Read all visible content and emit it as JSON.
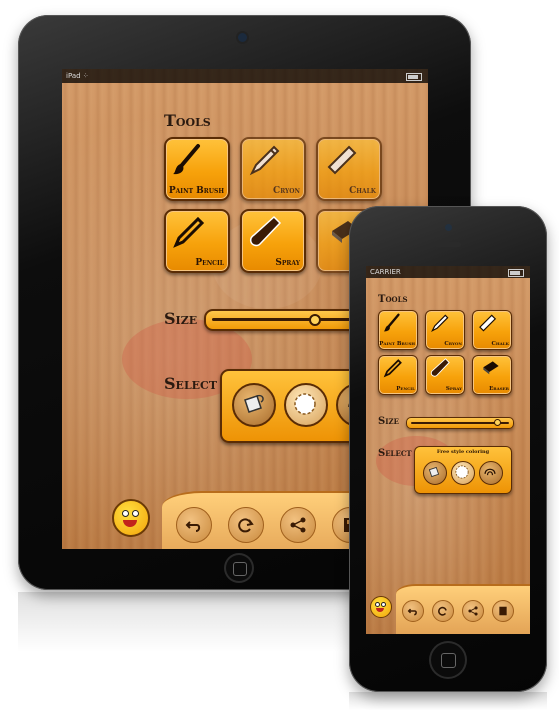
{
  "ipad": {
    "tools_title": "Tools",
    "tools": [
      {
        "label": "Paint Brush",
        "icon": "paint-brush-icon"
      },
      {
        "label": "Cryon",
        "icon": "crayon-icon"
      },
      {
        "label": "Chalk",
        "icon": "chalk-icon"
      },
      {
        "label": "Pencil",
        "icon": "pencil-icon"
      },
      {
        "label": "Spray",
        "icon": "spray-icon"
      },
      {
        "label": "",
        "icon": "eraser-icon"
      }
    ],
    "size_title": "Size",
    "size_value": 0.68,
    "select_title": "Select",
    "toolbar": [
      "undo-icon",
      "redo-icon",
      "share-icon",
      "save-icon"
    ]
  },
  "iphone": {
    "carrier": "CARRIER",
    "tools_title": "Tools",
    "tools": [
      {
        "label": "Paint Brush",
        "icon": "paint-brush-icon"
      },
      {
        "label": "Cryon",
        "icon": "crayon-icon"
      },
      {
        "label": "Chalk",
        "icon": "chalk-icon"
      },
      {
        "label": "Pencil",
        "icon": "pencil-icon"
      },
      {
        "label": "Spray",
        "icon": "spray-icon"
      },
      {
        "label": "Eraser",
        "icon": "eraser-icon"
      }
    ],
    "size_title": "Size",
    "size_value": 0.88,
    "select_title": "Select",
    "select_caption": "Free style coloring",
    "toolbar": [
      "undo-icon",
      "redo-icon",
      "share-icon",
      "save-icon"
    ]
  },
  "colors": {
    "button": "#f7a20b",
    "border": "#5a2c05",
    "wood": "#c88b57"
  }
}
